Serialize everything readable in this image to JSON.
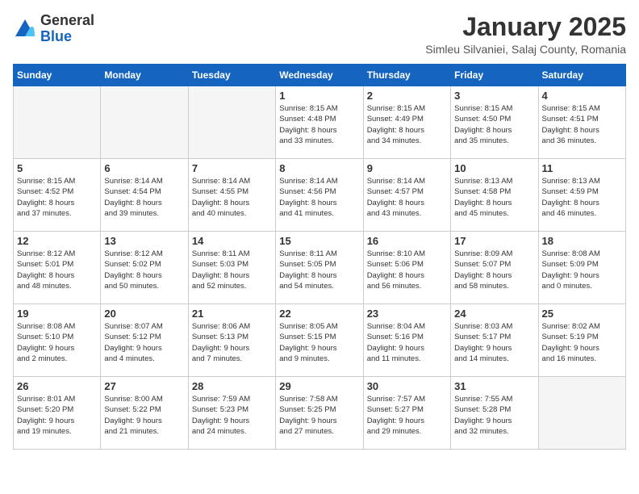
{
  "logo": {
    "general": "General",
    "blue": "Blue"
  },
  "title": "January 2025",
  "location": "Simleu Silvaniei, Salaj County, Romania",
  "days_of_week": [
    "Sunday",
    "Monday",
    "Tuesday",
    "Wednesday",
    "Thursday",
    "Friday",
    "Saturday"
  ],
  "weeks": [
    [
      {
        "day": "",
        "info": ""
      },
      {
        "day": "",
        "info": ""
      },
      {
        "day": "",
        "info": ""
      },
      {
        "day": "1",
        "info": "Sunrise: 8:15 AM\nSunset: 4:48 PM\nDaylight: 8 hours\nand 33 minutes."
      },
      {
        "day": "2",
        "info": "Sunrise: 8:15 AM\nSunset: 4:49 PM\nDaylight: 8 hours\nand 34 minutes."
      },
      {
        "day": "3",
        "info": "Sunrise: 8:15 AM\nSunset: 4:50 PM\nDaylight: 8 hours\nand 35 minutes."
      },
      {
        "day": "4",
        "info": "Sunrise: 8:15 AM\nSunset: 4:51 PM\nDaylight: 8 hours\nand 36 minutes."
      }
    ],
    [
      {
        "day": "5",
        "info": "Sunrise: 8:15 AM\nSunset: 4:52 PM\nDaylight: 8 hours\nand 37 minutes."
      },
      {
        "day": "6",
        "info": "Sunrise: 8:14 AM\nSunset: 4:54 PM\nDaylight: 8 hours\nand 39 minutes."
      },
      {
        "day": "7",
        "info": "Sunrise: 8:14 AM\nSunset: 4:55 PM\nDaylight: 8 hours\nand 40 minutes."
      },
      {
        "day": "8",
        "info": "Sunrise: 8:14 AM\nSunset: 4:56 PM\nDaylight: 8 hours\nand 41 minutes."
      },
      {
        "day": "9",
        "info": "Sunrise: 8:14 AM\nSunset: 4:57 PM\nDaylight: 8 hours\nand 43 minutes."
      },
      {
        "day": "10",
        "info": "Sunrise: 8:13 AM\nSunset: 4:58 PM\nDaylight: 8 hours\nand 45 minutes."
      },
      {
        "day": "11",
        "info": "Sunrise: 8:13 AM\nSunset: 4:59 PM\nDaylight: 8 hours\nand 46 minutes."
      }
    ],
    [
      {
        "day": "12",
        "info": "Sunrise: 8:12 AM\nSunset: 5:01 PM\nDaylight: 8 hours\nand 48 minutes."
      },
      {
        "day": "13",
        "info": "Sunrise: 8:12 AM\nSunset: 5:02 PM\nDaylight: 8 hours\nand 50 minutes."
      },
      {
        "day": "14",
        "info": "Sunrise: 8:11 AM\nSunset: 5:03 PM\nDaylight: 8 hours\nand 52 minutes."
      },
      {
        "day": "15",
        "info": "Sunrise: 8:11 AM\nSunset: 5:05 PM\nDaylight: 8 hours\nand 54 minutes."
      },
      {
        "day": "16",
        "info": "Sunrise: 8:10 AM\nSunset: 5:06 PM\nDaylight: 8 hours\nand 56 minutes."
      },
      {
        "day": "17",
        "info": "Sunrise: 8:09 AM\nSunset: 5:07 PM\nDaylight: 8 hours\nand 58 minutes."
      },
      {
        "day": "18",
        "info": "Sunrise: 8:08 AM\nSunset: 5:09 PM\nDaylight: 9 hours\nand 0 minutes."
      }
    ],
    [
      {
        "day": "19",
        "info": "Sunrise: 8:08 AM\nSunset: 5:10 PM\nDaylight: 9 hours\nand 2 minutes."
      },
      {
        "day": "20",
        "info": "Sunrise: 8:07 AM\nSunset: 5:12 PM\nDaylight: 9 hours\nand 4 minutes."
      },
      {
        "day": "21",
        "info": "Sunrise: 8:06 AM\nSunset: 5:13 PM\nDaylight: 9 hours\nand 7 minutes."
      },
      {
        "day": "22",
        "info": "Sunrise: 8:05 AM\nSunset: 5:15 PM\nDaylight: 9 hours\nand 9 minutes."
      },
      {
        "day": "23",
        "info": "Sunrise: 8:04 AM\nSunset: 5:16 PM\nDaylight: 9 hours\nand 11 minutes."
      },
      {
        "day": "24",
        "info": "Sunrise: 8:03 AM\nSunset: 5:17 PM\nDaylight: 9 hours\nand 14 minutes."
      },
      {
        "day": "25",
        "info": "Sunrise: 8:02 AM\nSunset: 5:19 PM\nDaylight: 9 hours\nand 16 minutes."
      }
    ],
    [
      {
        "day": "26",
        "info": "Sunrise: 8:01 AM\nSunset: 5:20 PM\nDaylight: 9 hours\nand 19 minutes."
      },
      {
        "day": "27",
        "info": "Sunrise: 8:00 AM\nSunset: 5:22 PM\nDaylight: 9 hours\nand 21 minutes."
      },
      {
        "day": "28",
        "info": "Sunrise: 7:59 AM\nSunset: 5:23 PM\nDaylight: 9 hours\nand 24 minutes."
      },
      {
        "day": "29",
        "info": "Sunrise: 7:58 AM\nSunset: 5:25 PM\nDaylight: 9 hours\nand 27 minutes."
      },
      {
        "day": "30",
        "info": "Sunrise: 7:57 AM\nSunset: 5:27 PM\nDaylight: 9 hours\nand 29 minutes."
      },
      {
        "day": "31",
        "info": "Sunrise: 7:55 AM\nSunset: 5:28 PM\nDaylight: 9 hours\nand 32 minutes."
      },
      {
        "day": "",
        "info": ""
      }
    ]
  ]
}
